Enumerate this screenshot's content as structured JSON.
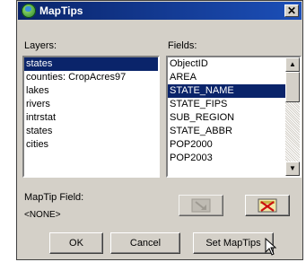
{
  "window": {
    "title": "MapTips",
    "close_glyph": "✕"
  },
  "layers": {
    "label": "Layers:",
    "items": [
      "states",
      "counties: CropAcres97",
      "lakes",
      "rivers",
      "intrstat",
      "states",
      "cities"
    ],
    "selected_index": 0
  },
  "fields": {
    "label": "Fields:",
    "items": [
      "ObjectID",
      "AREA",
      "STATE_NAME",
      "STATE_FIPS",
      "SUB_REGION",
      "STATE_ABBR",
      "POP2000",
      "POP2003"
    ],
    "selected_index": 2
  },
  "maptip": {
    "label": "MapTip Field:",
    "value": "<NONE>"
  },
  "buttons": {
    "ok": "OK",
    "cancel": "Cancel",
    "set": "Set MapTips"
  },
  "icons": {
    "add_field": "add-field-icon",
    "remove_field": "remove-field-icon",
    "app": "maptips-globe-icon",
    "cursor": "mouse-pointer-icon"
  }
}
